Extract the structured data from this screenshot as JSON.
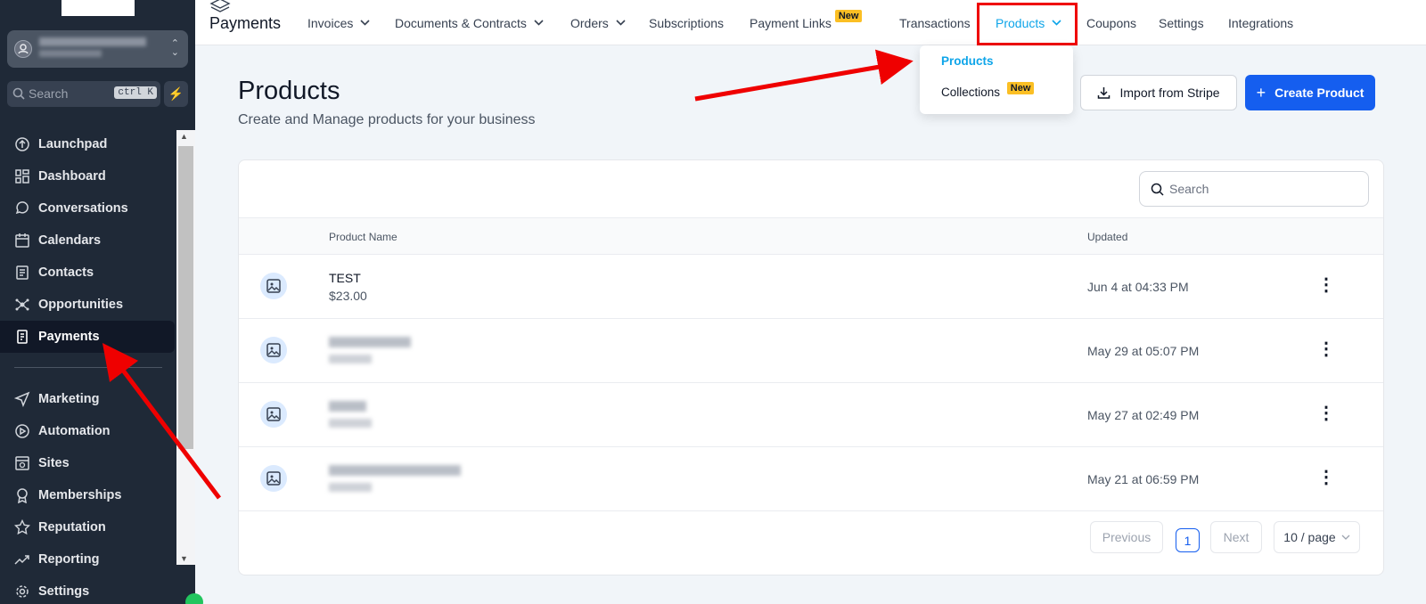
{
  "sidebar": {
    "search_placeholder": "Search",
    "search_shortcut": "ctrl K",
    "items": [
      {
        "label": "Launchpad",
        "icon": "rocket-icon"
      },
      {
        "label": "Dashboard",
        "icon": "dashboard-icon"
      },
      {
        "label": "Conversations",
        "icon": "chat-icon"
      },
      {
        "label": "Calendars",
        "icon": "calendar-icon"
      },
      {
        "label": "Contacts",
        "icon": "contacts-icon"
      },
      {
        "label": "Opportunities",
        "icon": "network-icon"
      },
      {
        "label": "Payments",
        "icon": "receipt-icon",
        "active": true
      },
      {
        "label": "Marketing",
        "icon": "send-icon"
      },
      {
        "label": "Automation",
        "icon": "play-circle-icon"
      },
      {
        "label": "Sites",
        "icon": "browser-icon"
      },
      {
        "label": "Memberships",
        "icon": "badge-icon"
      },
      {
        "label": "Reputation",
        "icon": "star-icon"
      },
      {
        "label": "Reporting",
        "icon": "chart-line-icon"
      },
      {
        "label": "Settings",
        "icon": "gear-icon"
      }
    ]
  },
  "topbar": {
    "app_title": "Payments",
    "nav": {
      "invoices": "Invoices",
      "documents": "Documents & Contracts",
      "orders": "Orders",
      "subscriptions": "Subscriptions",
      "payment_links": "Payment Links",
      "payment_links_badge": "New",
      "transactions": "Transactions",
      "products": "Products",
      "coupons": "Coupons",
      "settings": "Settings",
      "integrations": "Integrations"
    },
    "dropdown": {
      "products": "Products",
      "collections": "Collections",
      "collections_badge": "New"
    }
  },
  "main": {
    "title": "Products",
    "subtitle": "Create and Manage products for your business",
    "import_button": "Import from Stripe",
    "create_button": "Create Product",
    "search_placeholder": "Search",
    "columns": {
      "name": "Product Name",
      "updated": "Updated"
    },
    "rows": [
      {
        "name": "TEST",
        "price": "$23.00",
        "updated": "Jun 4 at 04:33 PM"
      },
      {
        "name": "",
        "price": "",
        "updated": "May 29 at 05:07 PM"
      },
      {
        "name": "",
        "price": "",
        "updated": "May 27 at 02:49 PM"
      },
      {
        "name": "",
        "price": "",
        "updated": "May 21 at 06:59 PM"
      }
    ],
    "pagination": {
      "previous": "Previous",
      "current": "1",
      "next": "Next",
      "per_page": "10 / page"
    }
  },
  "colors": {
    "accent": "#155eef",
    "link_active": "#0ea5e9",
    "sidebar_bg": "#1f2937",
    "badge": "#fbbf24",
    "annotation": "#ef0000"
  }
}
